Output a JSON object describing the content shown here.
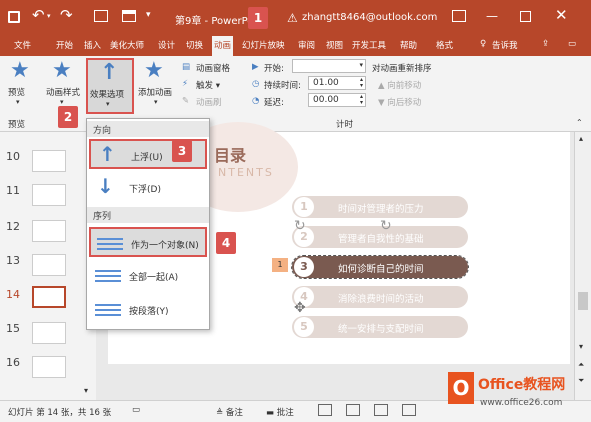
{
  "titlebar": {
    "chapter": "第9章",
    "app": "PowerPoint",
    "warning_email": "zhangtt8464@outlook.com"
  },
  "tabs": [
    "文件",
    "开始",
    "插入",
    "美化大师",
    "设计",
    "切换",
    "动画",
    "幻灯片放映",
    "审阅",
    "视图",
    "开发工具",
    "帮助",
    "格式"
  ],
  "active_tab": "动画",
  "tell_me": "告诉我",
  "ribbon": {
    "preview": "预览",
    "preview_group": "预览",
    "anim_style": "动画样式",
    "effect_options": "效果选项",
    "add_anim": "添加动画",
    "anim_pane": "动画窗格",
    "trigger": "触发",
    "anim_brush": "动画刷",
    "start_label": "开始:",
    "start_value": "",
    "duration_label": "持续时间:",
    "duration_value": "01.00",
    "delay_label": "延迟:",
    "delay_value": "00.00",
    "timing_group": "计时",
    "reorder_title": "对动画重新排序",
    "move_earlier": "向前移动",
    "move_later": "向后移动"
  },
  "dropdown": {
    "direction_header": "方向",
    "float_up": "上浮(U)",
    "float_down": "下浮(D)",
    "sequence_header": "序列",
    "as_one_object": "作为一个对象(N)",
    "all_at_once": "全部一起(A)",
    "by_paragraph": "按段落(Y)"
  },
  "slides": [
    "10",
    "11",
    "12",
    "13",
    "14",
    "15",
    "16"
  ],
  "current_slide": "14",
  "slide_content": {
    "title_partial": "目录",
    "subtitle_partial": "NTENTS",
    "anim_tag": "1",
    "items": [
      {
        "num": "1",
        "text": "时间对管理者的压力"
      },
      {
        "num": "2",
        "text": "管理者自我性的基础"
      },
      {
        "num": "3",
        "text": "如何诊断自己的时间"
      },
      {
        "num": "4",
        "text": "消除浪费时间的活动"
      },
      {
        "num": "5",
        "text": "统一安排与支配时间"
      }
    ]
  },
  "steps": [
    "1",
    "2",
    "3",
    "4"
  ],
  "statusbar": {
    "slide_info": "幻灯片 第 14 张，共 16 张",
    "notes": "备注",
    "comments": "批注"
  },
  "watermark": {
    "brand": "Office教程网",
    "url": "www.office26.com"
  },
  "colors": {
    "accent": "#b7472a",
    "highlight": "#d9534f",
    "item_bar": "#e3d8d3",
    "item_bar_selected": "#7a5a50"
  }
}
